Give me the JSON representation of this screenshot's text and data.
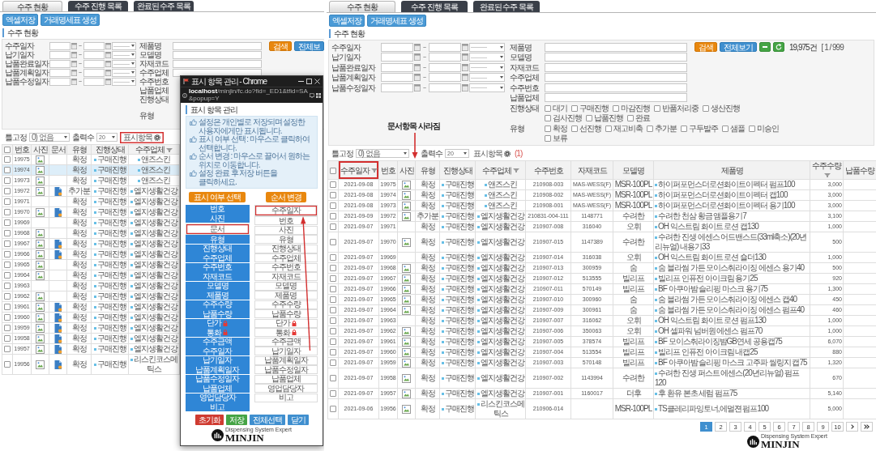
{
  "left_panel": {
    "tabs": [
      {
        "label": "수주 현황",
        "selected": true
      },
      {
        "label": "수주 진행 목록",
        "selected": false
      },
      {
        "label": "완료된 수주 목록",
        "selected": false
      }
    ],
    "actions": [
      "엑셀저장",
      "거래명세표 생성"
    ],
    "section_title": "수주 현황",
    "date_filters": [
      {
        "label": "수주일자",
        "separator": "~",
        "select": "----------"
      },
      {
        "label": "납기일자",
        "separator": "~",
        "select": "----------"
      },
      {
        "label": "납품완료일자",
        "separator": "~",
        "select": "----------"
      },
      {
        "label": "납품계획일자",
        "separator": "~",
        "select": "----------"
      },
      {
        "label": "납품수정일자",
        "separator": "~",
        "select": "----------"
      }
    ],
    "text_filters": [
      {
        "label": "제품명",
        "kind": "input"
      },
      {
        "label": "모델명",
        "kind": "input"
      },
      {
        "label": "자재코드",
        "kind": "input"
      },
      {
        "label": "수주업체",
        "kind": "input"
      },
      {
        "label": "수주번호",
        "kind": "covered"
      },
      {
        "label": "납품업체",
        "kind": "covered"
      },
      {
        "label": "진행상태",
        "kind": "covered-options"
      },
      {
        "label": "유형",
        "kind": "covered-options"
      }
    ],
    "buttons": [
      {
        "label": "검색",
        "kind": "search"
      },
      {
        "label": "전체보",
        "kind": "view-all"
      }
    ],
    "toolbar": {
      "freeze_label": "틀고정",
      "freeze_value": "0) 없음",
      "rows_label": "출력수",
      "rows_value": "20",
      "columns_button": "표시항목",
      "columns_highlighted": true
    },
    "table": {
      "select_all_checked": false,
      "columns": [
        {
          "label": "번호",
          "sort": false
        },
        {
          "label": "사진",
          "sort": false
        },
        {
          "label": "문서",
          "sort": false
        },
        {
          "label": "유형",
          "sort": false
        },
        {
          "label": "진행상태",
          "sort": false
        },
        {
          "label": "수주업체",
          "sort": true
        }
      ],
      "rows": [
        {
          "checked": false,
          "selected": false,
          "number": "19975",
          "photo": true,
          "document": false,
          "type": "확정",
          "status": "구매진행",
          "customer": "앤즈스킨"
        },
        {
          "checked": false,
          "selected": true,
          "number": "19974",
          "photo": true,
          "document": false,
          "type": "확정",
          "status": "구매진행",
          "customer": "앤즈스킨"
        },
        {
          "checked": false,
          "selected": false,
          "number": "19973",
          "photo": true,
          "document": false,
          "type": "확정",
          "status": "구매진행",
          "customer": "앤즈스킨"
        },
        {
          "checked": false,
          "selected": false,
          "number": "19972",
          "photo": true,
          "document": true,
          "type": "추가분",
          "status": "구매진행",
          "customer": "엘지생활건강"
        },
        {
          "checked": false,
          "selected": false,
          "number": "19971",
          "photo": false,
          "document": false,
          "type": "확정",
          "status": "구매진행",
          "customer": "엘지생활건강"
        },
        {
          "checked": false,
          "selected": false,
          "number": "19970",
          "photo": true,
          "document": true,
          "type": "확정",
          "status": "구매진행",
          "customer": "엘지생활건강"
        },
        {
          "checked": false,
          "selected": false,
          "number": "19969",
          "photo": false,
          "document": false,
          "type": "확정",
          "status": "구매진행",
          "customer": "엘지생활건강"
        },
        {
          "checked": false,
          "selected": false,
          "number": "19968",
          "photo": true,
          "document": false,
          "type": "확정",
          "status": "구매진행",
          "customer": "엘지생활건강"
        },
        {
          "checked": false,
          "selected": false,
          "number": "19967",
          "photo": true,
          "document": true,
          "type": "확정",
          "status": "구매진행",
          "customer": "엘지생활건강"
        },
        {
          "checked": false,
          "selected": false,
          "number": "19966",
          "photo": true,
          "document": true,
          "type": "확정",
          "status": "구매진행",
          "customer": "엘지생활건강"
        },
        {
          "checked": false,
          "selected": false,
          "number": "19965",
          "photo": true,
          "document": false,
          "type": "확정",
          "status": "구매진행",
          "customer": "엘지생활건강"
        },
        {
          "checked": false,
          "selected": false,
          "number": "19964",
          "photo": true,
          "document": false,
          "type": "확정",
          "status": "구매진행",
          "customer": "엘지생활건강"
        },
        {
          "checked": false,
          "selected": false,
          "number": "19963",
          "photo": false,
          "document": false,
          "type": "확정",
          "status": "구매진행",
          "customer": "엘지생활건강"
        },
        {
          "checked": false,
          "selected": false,
          "number": "19962",
          "photo": true,
          "document": false,
          "type": "확정",
          "status": "구매진행",
          "customer": "엘지생활건강"
        },
        {
          "checked": false,
          "selected": false,
          "number": "19961",
          "photo": true,
          "document": true,
          "type": "확정",
          "status": "구매진행",
          "customer": "엘지생활건강"
        },
        {
          "checked": false,
          "selected": false,
          "number": "19960",
          "photo": true,
          "document": true,
          "type": "확정",
          "status": "구매진행",
          "customer": "엘지생활건강"
        },
        {
          "checked": false,
          "selected": false,
          "number": "19959",
          "photo": true,
          "document": true,
          "type": "확정",
          "status": "구매진행",
          "customer": "엘지생활건강"
        },
        {
          "checked": false,
          "selected": false,
          "number": "19958",
          "photo": true,
          "document": true,
          "type": "확정",
          "status": "구매진행",
          "customer": "엘지생활건강"
        },
        {
          "checked": false,
          "selected": false,
          "number": "19957",
          "photo": true,
          "document": true,
          "type": "확정",
          "status": "구매진행",
          "customer": "엘지생활건강"
        },
        {
          "checked": false,
          "selected": false,
          "number": "19956",
          "photo": true,
          "document": true,
          "type": "확정",
          "status": "구매진행",
          "customer": "리스킨코스메틱스"
        }
      ]
    }
  },
  "popup": {
    "title": "표시 항목 관리 - Chrome",
    "url": "**localhost**/minjin/fc.do?fid=_ED1&tfid=SA&popup=Y",
    "heading": "표시 항목 관리",
    "notes": [
      "설정은 개인별로 저장되며 설정한 사용자에게만 표시됩니다.",
      "표시 여부 선택 : 마우스로 클릭하여 선택합니다.",
      "순서 변경 : 마우스로 끌어서 원하는 위치로 이동합니다.",
      "설정 완료 후 저장 버튼을 클릭하세요."
    ],
    "visible_header": "표시 여부 선택",
    "order_header": "순서 변경",
    "visible_items": [
      {
        "label": "번호",
        "selected": true,
        "locked": false,
        "highlighted": false
      },
      {
        "label": "사진",
        "selected": true,
        "locked": false,
        "highlighted": false
      },
      {
        "label": "문서",
        "selected": false,
        "locked": false,
        "highlighted": true
      },
      {
        "label": "유형",
        "selected": true,
        "locked": false,
        "highlighted": false
      },
      {
        "label": "진행상태",
        "selected": true,
        "locked": false,
        "highlighted": false
      },
      {
        "label": "수주업체",
        "selected": true,
        "locked": false,
        "highlighted": false
      },
      {
        "label": "수주번호",
        "selected": true,
        "locked": false,
        "highlighted": false
      },
      {
        "label": "자재코드",
        "selected": true,
        "locked": false,
        "highlighted": false
      },
      {
        "label": "모델명",
        "selected": true,
        "locked": false,
        "highlighted": false
      },
      {
        "label": "제품명",
        "selected": true,
        "locked": false,
        "highlighted": false
      },
      {
        "label": "수주수량",
        "selected": true,
        "locked": false,
        "highlighted": false
      },
      {
        "label": "납품수량",
        "selected": true,
        "locked": false,
        "highlighted": false
      },
      {
        "label": "단가",
        "selected": true,
        "locked": true,
        "highlighted": false
      },
      {
        "label": "통화",
        "selected": true,
        "locked": true,
        "highlighted": false
      },
      {
        "label": "수주금액",
        "selected": true,
        "locked": false,
        "highlighted": false
      },
      {
        "label": "수주일자",
        "selected": true,
        "locked": false,
        "highlighted": false
      },
      {
        "label": "납기일자",
        "selected": true,
        "locked": false,
        "highlighted": false
      },
      {
        "label": "납품계획일자",
        "selected": true,
        "locked": false,
        "highlighted": false
      },
      {
        "label": "납품수정일자",
        "selected": true,
        "locked": false,
        "highlighted": false
      },
      {
        "label": "납품업체",
        "selected": true,
        "locked": false,
        "highlighted": false
      },
      {
        "label": "영업담당자",
        "selected": true,
        "locked": false,
        "highlighted": false
      },
      {
        "label": "비고",
        "selected": true,
        "locked": false,
        "highlighted": false
      }
    ],
    "order_items": [
      {
        "label": "수주일자",
        "locked": false,
        "highlighted": true
      },
      {
        "label": "번호",
        "locked": false,
        "highlighted": false
      },
      {
        "label": "사진",
        "locked": false,
        "highlighted": false
      },
      {
        "label": "유형",
        "locked": false,
        "highlighted": false
      },
      {
        "label": "진행상태",
        "locked": false,
        "highlighted": false
      },
      {
        "label": "수주업체",
        "locked": false,
        "highlighted": false
      },
      {
        "label": "수주번호",
        "locked": false,
        "highlighted": false
      },
      {
        "label": "자재코드",
        "locked": false,
        "highlighted": false
      },
      {
        "label": "모델명",
        "locked": false,
        "highlighted": false
      },
      {
        "label": "제품명",
        "locked": false,
        "highlighted": false
      },
      {
        "label": "수주수량",
        "locked": false,
        "highlighted": false
      },
      {
        "label": "납품수량",
        "locked": false,
        "highlighted": false
      },
      {
        "label": "단가",
        "locked": true,
        "highlighted": false
      },
      {
        "label": "통화",
        "locked": true,
        "highlighted": false
      },
      {
        "label": "수주금액",
        "locked": false,
        "highlighted": false
      },
      {
        "label": "납기일자",
        "locked": false,
        "highlighted": false
      },
      {
        "label": "납품계획일자",
        "locked": false,
        "highlighted": false
      },
      {
        "label": "납품수정일자",
        "locked": false,
        "highlighted": false
      },
      {
        "label": "납품업체",
        "locked": false,
        "highlighted": false
      },
      {
        "label": "영업담당자",
        "locked": false,
        "highlighted": false
      },
      {
        "label": "비고",
        "locked": false,
        "highlighted": false
      }
    ],
    "buttons": [
      {
        "label": "초기화",
        "kind": "reset"
      },
      {
        "label": "저장",
        "kind": "save"
      },
      {
        "label": "전체선택",
        "kind": "select-all"
      },
      {
        "label": "닫기",
        "kind": "close"
      }
    ],
    "logo": {
      "tagline": "Dispensing System Expert",
      "name": "MINJIN"
    }
  },
  "right_panel": {
    "tabs": [
      {
        "label": "수주 현황",
        "selected": true
      },
      {
        "label": "수주 진행 목록",
        "selected": false
      },
      {
        "label": "완료된 수주 목록",
        "selected": false
      }
    ],
    "actions": [
      "엑셀저장",
      "거래명세표 생성"
    ],
    "section_title": "수주 현황",
    "date_filters": [
      {
        "label": "수주일자",
        "separator": "~",
        "select": "----------"
      },
      {
        "label": "납기일자",
        "separator": "~",
        "select": "----------"
      },
      {
        "label": "납품완료일자",
        "separator": "~",
        "select": "----------"
      },
      {
        "label": "납품계획일자",
        "separator": "~",
        "select": "----------"
      },
      {
        "label": "납품수정일자",
        "separator": "~",
        "select": "----------"
      }
    ],
    "text_filters": [
      {
        "label": "제품명",
        "kind": "input"
      },
      {
        "label": "모델명",
        "kind": "input"
      },
      {
        "label": "자재코드",
        "kind": "input"
      },
      {
        "label": "수주업체",
        "kind": "input"
      },
      {
        "label": "수주번호",
        "kind": "input"
      },
      {
        "label": "납품업체",
        "kind": "input"
      }
    ],
    "option_groups": [
      {
        "label": "진행상태",
        "options": [
          {
            "label": "대기",
            "checked": false
          },
          {
            "label": "구매진행",
            "checked": false
          },
          {
            "label": "마감진행",
            "checked": false
          },
          {
            "label": "반품처리중",
            "checked": false
          },
          {
            "label": "생산진행",
            "checked": false
          },
          {
            "label": "검사진행",
            "checked": false
          },
          {
            "label": "납품진행",
            "checked": false
          },
          {
            "label": "완료",
            "checked": false
          }
        ]
      },
      {
        "label": "유형",
        "options": [
          {
            "label": "확정",
            "checked": false
          },
          {
            "label": "선진행",
            "checked": false
          },
          {
            "label": "재고비축",
            "checked": false
          },
          {
            "label": "추가분",
            "checked": false
          },
          {
            "label": "구두발주",
            "checked": false
          },
          {
            "label": "샘플",
            "checked": false
          },
          {
            "label": "미승인",
            "checked": false
          },
          {
            "label": "보류",
            "checked": false
          }
        ]
      }
    ],
    "buttons": [
      {
        "label": "검색",
        "kind": "search"
      },
      {
        "label": "전체보기",
        "kind": "view-all"
      },
      {
        "kind": "minus"
      },
      {
        "kind": "refresh"
      }
    ],
    "count": "19,975건",
    "page_info": "[ 1 / 999",
    "annotation": "문서항목 사라짐",
    "toolbar": {
      "freeze_label": "틀고정",
      "freeze_value": "0) 없음",
      "rows_label": "출력수",
      "rows_value": "20",
      "columns_button": "표시항목",
      "columns_highlighted": false,
      "columns_count": "(1)"
    },
    "table": {
      "select_all_checked": false,
      "columns": [
        {
          "label": "수주일자",
          "sort": true,
          "highlighted": true
        },
        {
          "label": "번호",
          "sort": false,
          "highlighted": false
        },
        {
          "label": "사진",
          "sort": false,
          "highlighted": false
        },
        {
          "label": "유형",
          "sort": false,
          "highlighted": false
        },
        {
          "label": "진행상태",
          "sort": false,
          "highlighted": false
        },
        {
          "label": "수주업체",
          "sort": true,
          "highlighted": false
        },
        {
          "label": "수주번호",
          "sort": false,
          "highlighted": false
        },
        {
          "label": "자재코드",
          "sort": false,
          "highlighted": false
        },
        {
          "label": "모델명",
          "sort": false,
          "highlighted": false
        },
        {
          "label": "제품명",
          "sort": false,
          "highlighted": false
        },
        {
          "label": "수주수량",
          "sort": true,
          "highlighted": false
        },
        {
          "label": "납품수량",
          "sort": false,
          "highlighted": false
        }
      ],
      "rows": [
        {
          "checked": false,
          "date": "2021-09-08",
          "number": "19975",
          "photo": true,
          "type": "확정",
          "status": "구매진행",
          "customer": "앤즈스킨",
          "order_no": "210908-003",
          "material_code": "MAS-WESS(F)",
          "model": "MSR-100PL",
          "product": "하이퍼포먼스더로션화이트이펙터 펌프100",
          "quantity": "3,000"
        },
        {
          "checked": false,
          "date": "2021-09-08",
          "number": "19974",
          "photo": true,
          "type": "확정",
          "status": "구매진행",
          "customer": "앤즈스킨",
          "order_no": "210908-002",
          "material_code": "MAS-WESS(F)",
          "model": "MSR-100PL",
          "product": "하이퍼포먼스더로션화이트이펙터 캡100",
          "quantity": "3,000"
        },
        {
          "checked": false,
          "date": "2021-09-08",
          "number": "19973",
          "photo": true,
          "type": "확정",
          "status": "구매진행",
          "customer": "앤즈스킨",
          "order_no": "210908-001",
          "material_code": "MAS-WESS(F)",
          "model": "MSR-100PL",
          "product": "하이퍼포먼스더로션화이트이펙터 용기100",
          "quantity": "3,000"
        },
        {
          "checked": false,
          "date": "2021-09-09",
          "number": "19972",
          "photo": true,
          "type": "추가분",
          "status": "구매진행",
          "customer": "엘지생활건강",
          "order_no": "210831-004-111",
          "material_code": "1148771",
          "model": "수려한",
          "product": "수려한 천삼 황금 앰플용기7",
          "quantity": "3,100"
        },
        {
          "checked": false,
          "date": "2021-09-07",
          "number": "19971",
          "photo": false,
          "type": "확정",
          "status": "구매진행",
          "customer": "엘지생활건강",
          "order_no": "210907-008",
          "material_code": "316040",
          "model": "오휘",
          "product": "OH 익스트림 화이트 로션 캡130",
          "quantity": "1,000"
        },
        {
          "checked": false,
          "date": "2021-09-07",
          "number": "19970",
          "photo": true,
          "type": "확정",
          "status": "구매진행",
          "customer": "엘지생활건강",
          "order_no": "210907-015",
          "material_code": "1147389",
          "model": "수려한",
          "product": "수려한 진생 에센스 어드밴스드(33ml축소)(20년리뉴얼) 내용기33",
          "quantity": "500"
        },
        {
          "checked": false,
          "date": "2021-09-07",
          "number": "19969",
          "photo": false,
          "type": "확정",
          "status": "구매진행",
          "customer": "엘지생활건강",
          "order_no": "210907-014",
          "material_code": "316038",
          "model": "오휘",
          "product": "OH 익스트림 화이트 로션 숄더130",
          "quantity": "1,000"
        },
        {
          "checked": false,
          "date": "2021-09-07",
          "number": "19968",
          "photo": true,
          "type": "확정",
          "status": "구매진행",
          "customer": "엘지생활건강",
          "order_no": "210907-013",
          "material_code": "300959",
          "model": "숨",
          "product": "숨 블라썸 가든 모이스춰라이징 에센스 용기40",
          "quantity": "500"
        },
        {
          "checked": false,
          "date": "2021-09-07",
          "number": "19967",
          "photo": true,
          "type": "확정",
          "status": "구매진행",
          "customer": "엘지생활건강",
          "order_no": "210907-012",
          "material_code": "513555",
          "model": "빌리프",
          "product": "빌리프 인퓨전 아이크림 용기25",
          "quantity": "920"
        },
        {
          "checked": false,
          "date": "2021-09-07",
          "number": "19966",
          "photo": true,
          "type": "확정",
          "status": "구매진행",
          "customer": "엘지생활건강",
          "order_no": "210907-011",
          "material_code": "570149",
          "model": "빌리프",
          "product": "BF 아쿠아밤 슬리핑 마스크 용기75",
          "quantity": "1,300"
        },
        {
          "checked": false,
          "date": "2021-09-07",
          "number": "19965",
          "photo": true,
          "type": "확정",
          "status": "구매진행",
          "customer": "엘지생활건강",
          "order_no": "210907-010",
          "material_code": "300960",
          "model": "숨",
          "product": "숨 블라썸 가든 모이스춰라이징 에센스 캡40",
          "quantity": "450"
        },
        {
          "checked": false,
          "date": "2021-09-07",
          "number": "19964",
          "photo": true,
          "type": "확정",
          "status": "구매진행",
          "customer": "엘지생활건강",
          "order_no": "210907-009",
          "material_code": "300961",
          "model": "숨",
          "product": "숨 블라썸 가든 모이스춰라이징 에센스 펌프40",
          "quantity": "460"
        },
        {
          "checked": false,
          "date": "2021-09-07",
          "number": "19963",
          "photo": false,
          "type": "확정",
          "status": "구매진행",
          "customer": "엘지생활건강",
          "order_no": "210907-007",
          "material_code": "316062",
          "model": "오휘",
          "product": "OH 익스트림 화이트 로션 펌프130",
          "quantity": "1,000"
        },
        {
          "checked": false,
          "date": "2021-09-07",
          "number": "19962",
          "photo": true,
          "type": "확정",
          "status": "구매진행",
          "customer": "엘지생활건강",
          "order_no": "210907-006",
          "material_code": "350063",
          "model": "오휘",
          "product": "OH 셀파워 넘버원 에센스 펌프70",
          "quantity": "1,000"
        },
        {
          "checked": false,
          "date": "2021-09-07",
          "number": "19961",
          "photo": true,
          "type": "확정",
          "status": "구매진행",
          "customer": "엘지생활건강",
          "order_no": "210907-005",
          "material_code": "378574",
          "model": "빌리프",
          "product": "BF 모이스춰라이징밤GB연세 공용캡75",
          "quantity": "6,070"
        },
        {
          "checked": false,
          "date": "2021-09-07",
          "number": "19960",
          "photo": true,
          "type": "확정",
          "status": "구매진행",
          "customer": "엘지생활건강",
          "order_no": "210907-004",
          "material_code": "513554",
          "model": "빌리프",
          "product": "빌리프 인퓨전 아이크림 내캡25",
          "quantity": "880"
        },
        {
          "checked": false,
          "date": "2021-09-07",
          "number": "19959",
          "photo": true,
          "type": "확정",
          "status": "구매진행",
          "customer": "엘지생활건강",
          "order_no": "210907-003",
          "material_code": "570148",
          "model": "빌리프",
          "product": "BF 아쿠아밤 슬리핑 마스크 고주파 씰링지 캡75",
          "quantity": "1,320"
        },
        {
          "checked": false,
          "date": "2021-09-07",
          "number": "19958",
          "photo": true,
          "type": "확정",
          "status": "구매진행",
          "customer": "엘지생활건강",
          "order_no": "210907-002",
          "material_code": "1143994",
          "model": "수려한",
          "product": "수려한 진생 퍼스트 에센스(20년리뉴얼) 펌프120",
          "quantity": "670"
        },
        {
          "checked": false,
          "date": "2021-09-07",
          "number": "19957",
          "photo": true,
          "type": "확정",
          "status": "구매진행",
          "customer": "엘지생활건강",
          "order_no": "210907-001",
          "material_code": "1160017",
          "model": "더후",
          "product": "후 환유 본초 세럼 펌프75",
          "quantity": "5,140"
        },
        {
          "checked": false,
          "date": "2021-09-06",
          "number": "19956",
          "photo": true,
          "type": "확정",
          "status": "구매진행",
          "customer": "리스킨코스메틱스",
          "order_no": "210906-014",
          "model": "MSR-100PL",
          "product": "TS클레리파잉토너,에멀젼 펌프100",
          "quantity": "5,000"
        }
      ]
    },
    "pagination": [
      {
        "label": "1",
        "selected": true
      },
      {
        "label": "2",
        "selected": false
      },
      {
        "label": "3",
        "selected": false
      },
      {
        "label": "4",
        "selected": false
      },
      {
        "label": "5",
        "selected": false
      },
      {
        "label": "6",
        "selected": false
      },
      {
        "label": "7",
        "selected": false
      },
      {
        "label": "8",
        "selected": false
      },
      {
        "label": "9",
        "selected": false
      },
      {
        "label": "10",
        "selected": false
      }
    ],
    "logo": {
      "tagline": "Dispensing System Expert",
      "name": "MINJIN"
    }
  }
}
